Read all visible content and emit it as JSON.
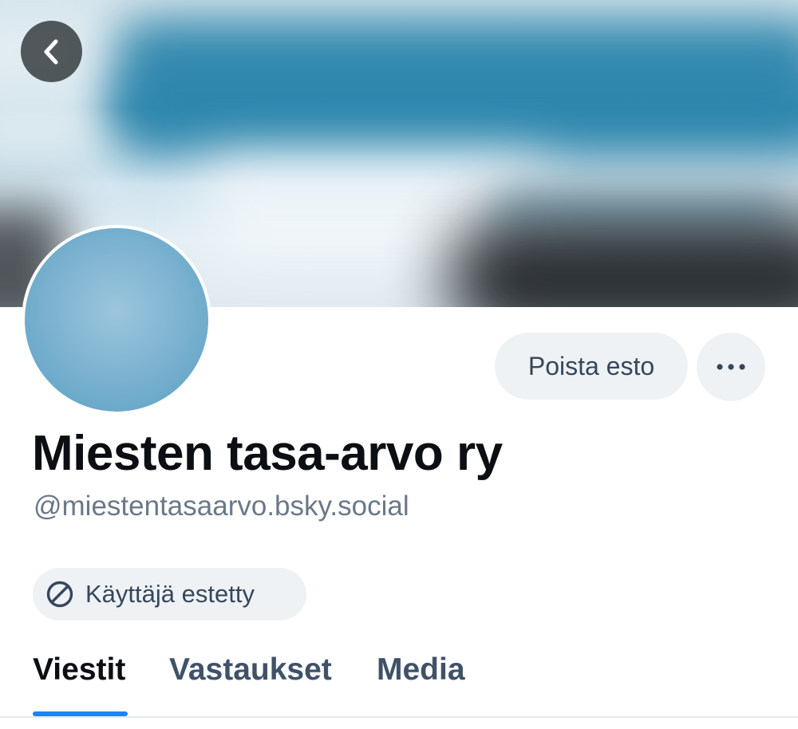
{
  "profile": {
    "display_name": "Miesten tasa-arvo ry",
    "handle": "@miestentasaarvo.bsky.social"
  },
  "actions": {
    "unblock_label": "Poista esto",
    "more_icon": "ellipsis-icon",
    "back_icon": "chevron-left-icon"
  },
  "badge": {
    "label": "Käyttäjä estetty",
    "icon": "block-icon"
  },
  "tabs": [
    {
      "label": "Viestit",
      "active": true
    },
    {
      "label": "Vastaukset",
      "active": false
    },
    {
      "label": "Media",
      "active": false
    }
  ],
  "colors": {
    "accent": "#1e84f1",
    "button_bg": "#eff2f5",
    "button_text": "#36475c",
    "handle_text": "#6b7888"
  }
}
